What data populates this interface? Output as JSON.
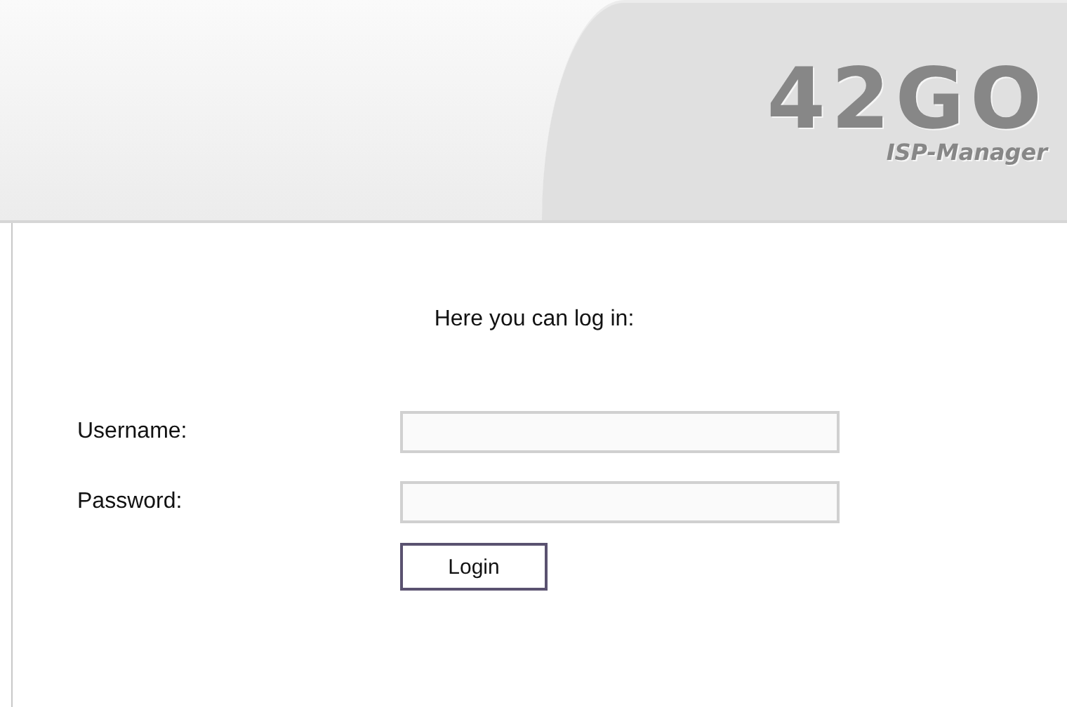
{
  "header": {
    "logo": "42GO",
    "logo_subtitle": "ISP-Manager"
  },
  "login": {
    "heading": "Here you can log in:",
    "fields": [
      {
        "label": "Username:"
      },
      {
        "label": "Password:"
      }
    ],
    "button": "Login"
  }
}
